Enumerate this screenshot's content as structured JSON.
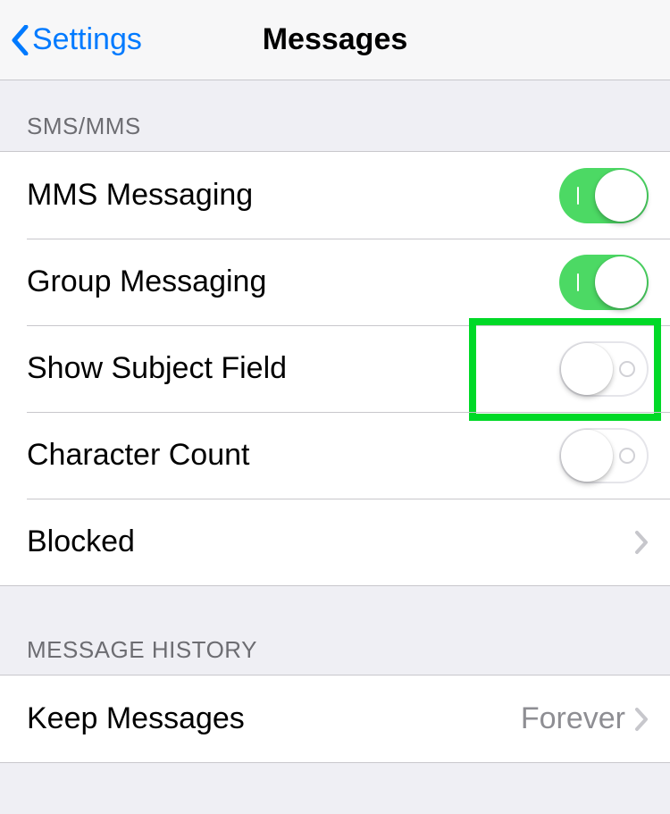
{
  "header": {
    "back_label": "Settings",
    "title": "Messages"
  },
  "section_sms_mms": {
    "header": "SMS/MMS",
    "rows": {
      "mms": {
        "label": "MMS Messaging",
        "on": true
      },
      "group": {
        "label": "Group Messaging",
        "on": true
      },
      "subject": {
        "label": "Show Subject Field",
        "on": false,
        "highlighted": true
      },
      "char_count": {
        "label": "Character Count",
        "on": false
      },
      "blocked": {
        "label": "Blocked"
      }
    }
  },
  "section_history": {
    "header": "MESSAGE HISTORY",
    "rows": {
      "keep": {
        "label": "Keep Messages",
        "value": "Forever"
      }
    }
  },
  "colors": {
    "tint": "#007AFF",
    "toggle_on": "#4CD964",
    "highlight_border": "#00D927"
  }
}
